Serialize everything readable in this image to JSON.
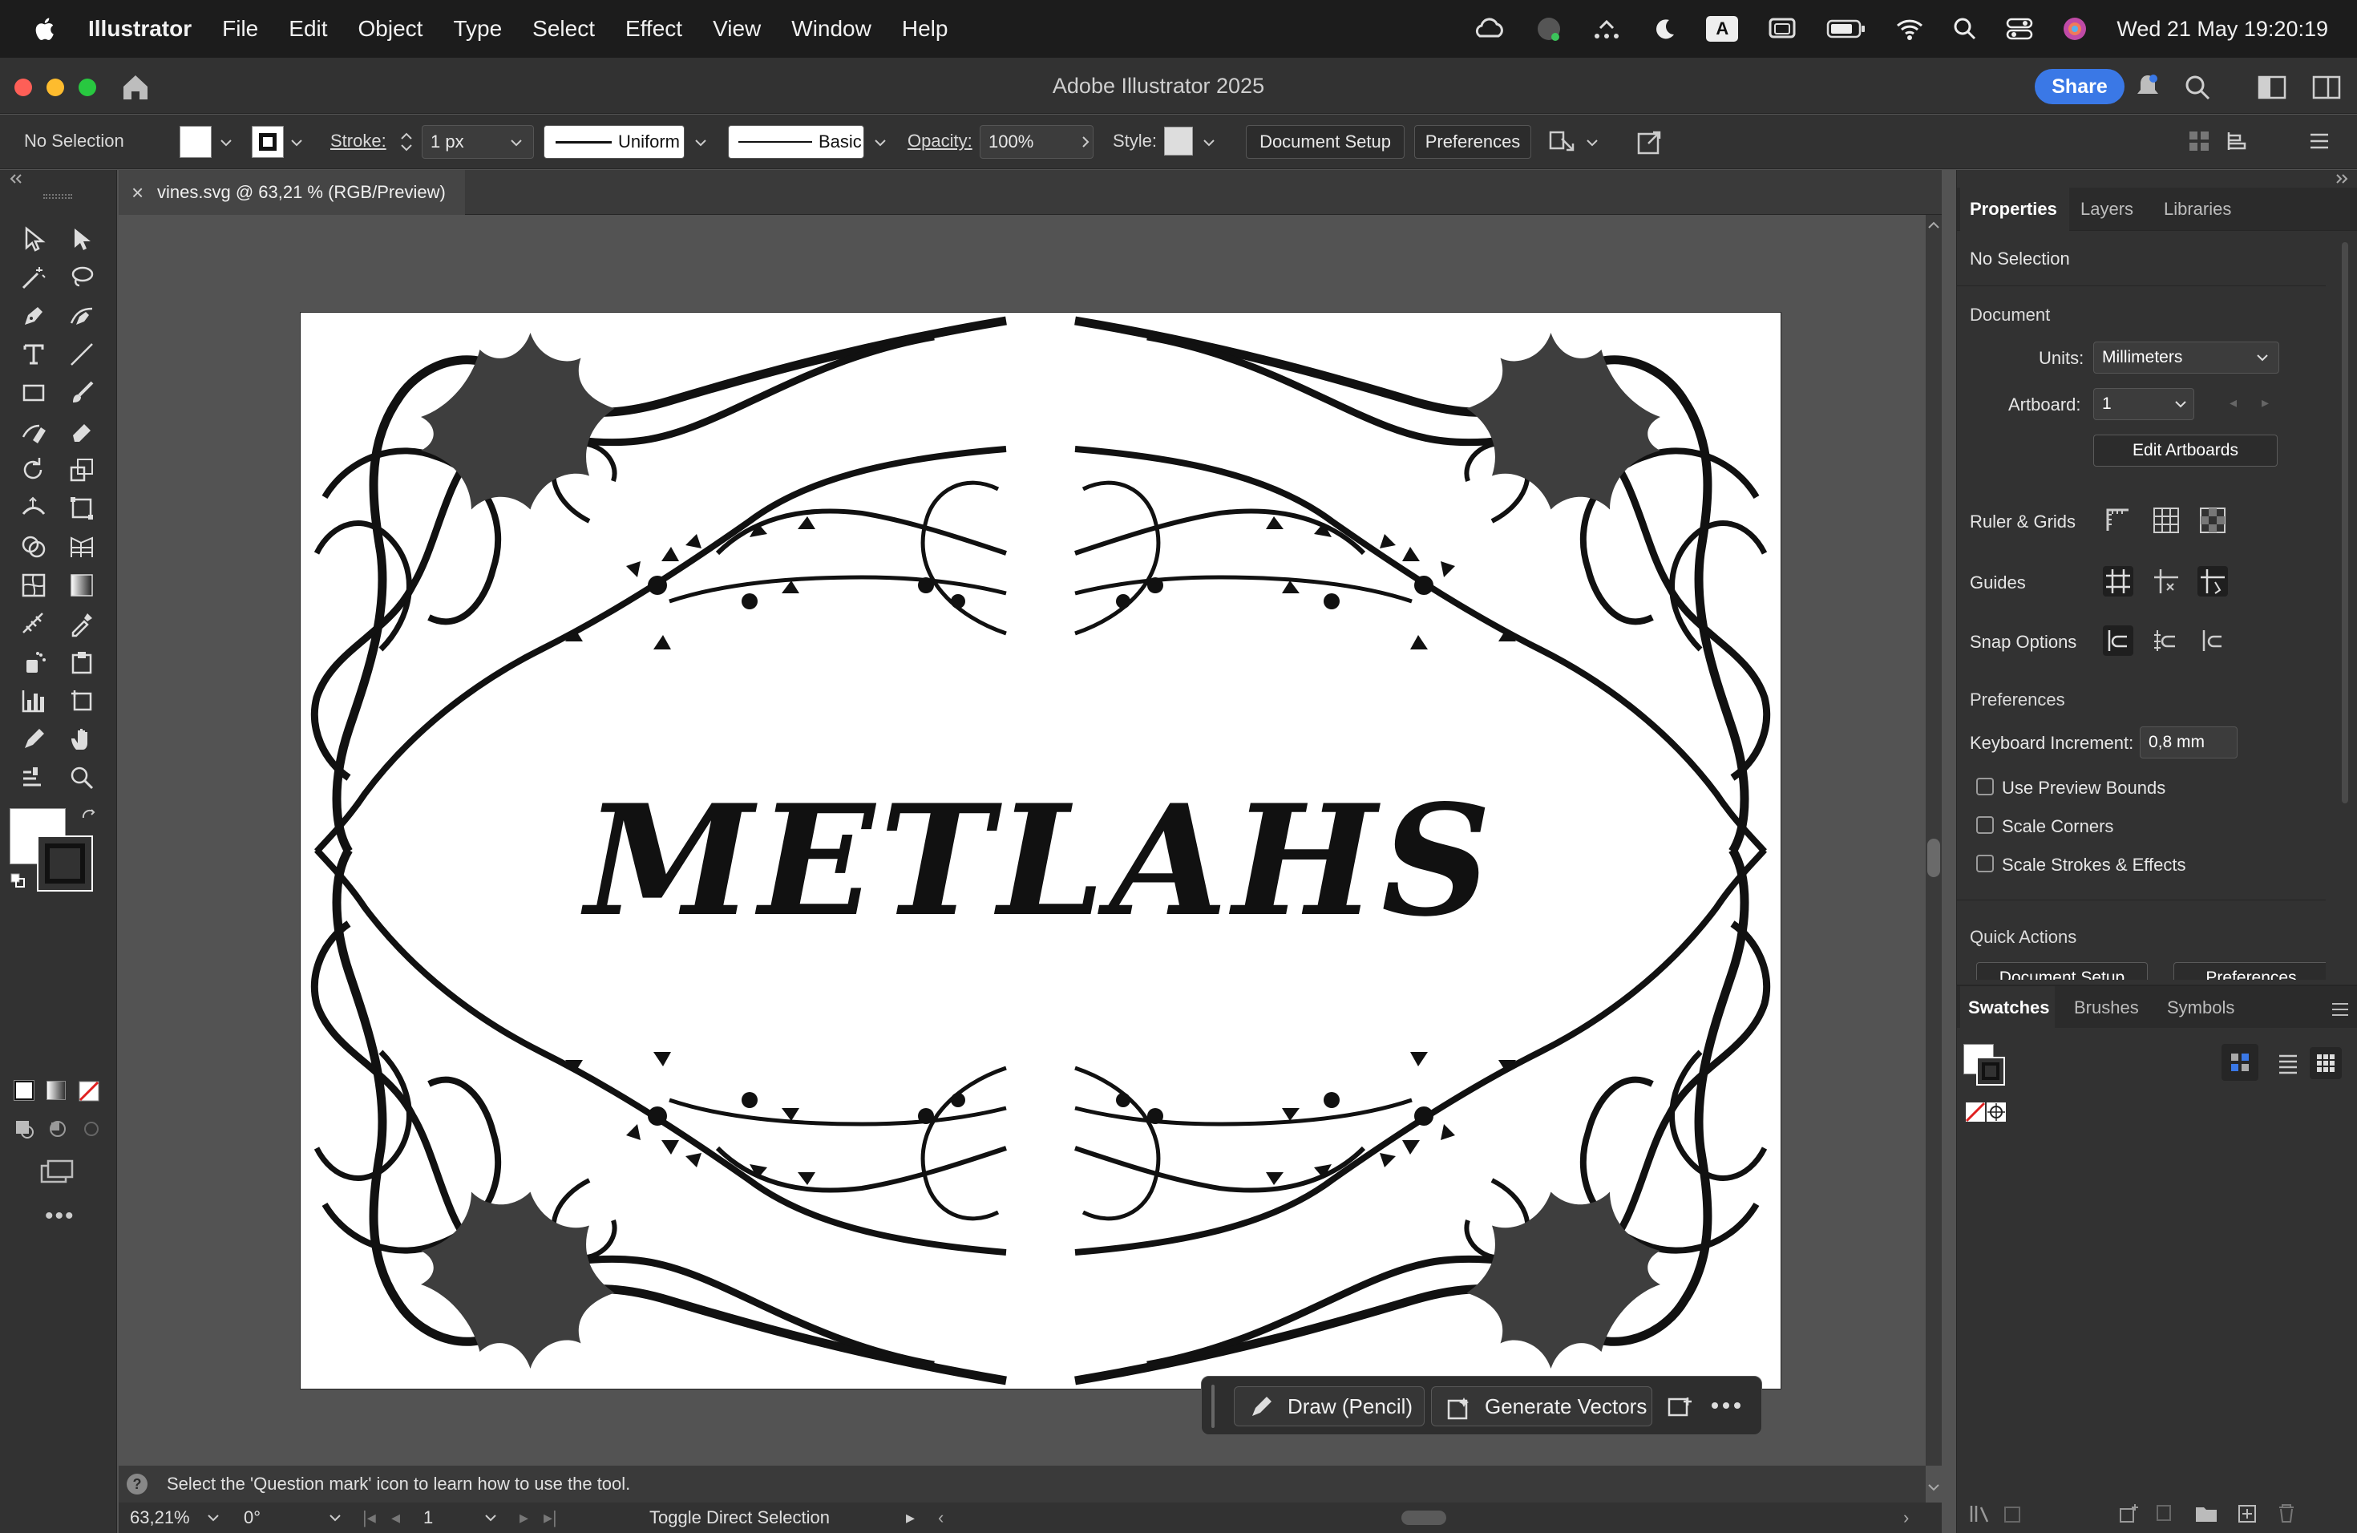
{
  "menubar": {
    "app_name": "Illustrator",
    "items": [
      "File",
      "Edit",
      "Object",
      "Type",
      "Select",
      "Effect",
      "View",
      "Window",
      "Help"
    ],
    "input_indicator": "A",
    "datetime": "Wed 21 May  19:20:19"
  },
  "window": {
    "title": "Adobe Illustrator 2025",
    "share_label": "Share"
  },
  "control_bar": {
    "selection_label": "No Selection",
    "stroke_label": "Stroke:",
    "stroke_value": "1 px",
    "profile_label": "Uniform",
    "brush_label": "Basic",
    "opacity_label": "Opacity:",
    "opacity_value": "100%",
    "style_label": "Style:",
    "document_setup_label": "Document Setup",
    "preferences_label": "Preferences"
  },
  "document": {
    "tab_title": "vines.svg @ 63,21 % (RGB/Preview)",
    "artwork_text": "METLAHS"
  },
  "taskbar": {
    "draw_label": "Draw (Pencil)",
    "generate_label": "Generate Vectors"
  },
  "hint": {
    "text": "Select the 'Question mark' icon to learn how to use the tool."
  },
  "status": {
    "zoom": "63,21%",
    "rotation": "0°",
    "artboard": "1",
    "tool_hint": "Toggle Direct Selection"
  },
  "properties_panel": {
    "tabs": [
      "Properties",
      "Layers",
      "Libraries"
    ],
    "selection": "No Selection",
    "document_heading": "Document",
    "units_label": "Units:",
    "units_value": "Millimeters",
    "artboard_label": "Artboard:",
    "artboard_value": "1",
    "edit_artboards_label": "Edit Artboards",
    "ruler_grids_label": "Ruler & Grids",
    "guides_label": "Guides",
    "snap_label": "Snap Options",
    "preferences_heading": "Preferences",
    "keyboard_increment_label": "Keyboard Increment:",
    "keyboard_increment_value": "0,8 mm",
    "checkboxes": [
      "Use Preview Bounds",
      "Scale Corners",
      "Scale Strokes & Effects"
    ],
    "quick_actions_heading": "Quick Actions",
    "quick_actions": [
      "Document Setup",
      "Preferences"
    ]
  },
  "swatches_panel": {
    "tabs": [
      "Swatches",
      "Brushes",
      "Symbols"
    ]
  },
  "colors": {
    "menubar_bg": "#1c1c1c",
    "panel_bg": "#323232",
    "canvas_bg": "#535353",
    "share_blue": "#3a78e6",
    "artwork_ink": "#111111",
    "leaf_gray": "#3e3e3e"
  }
}
